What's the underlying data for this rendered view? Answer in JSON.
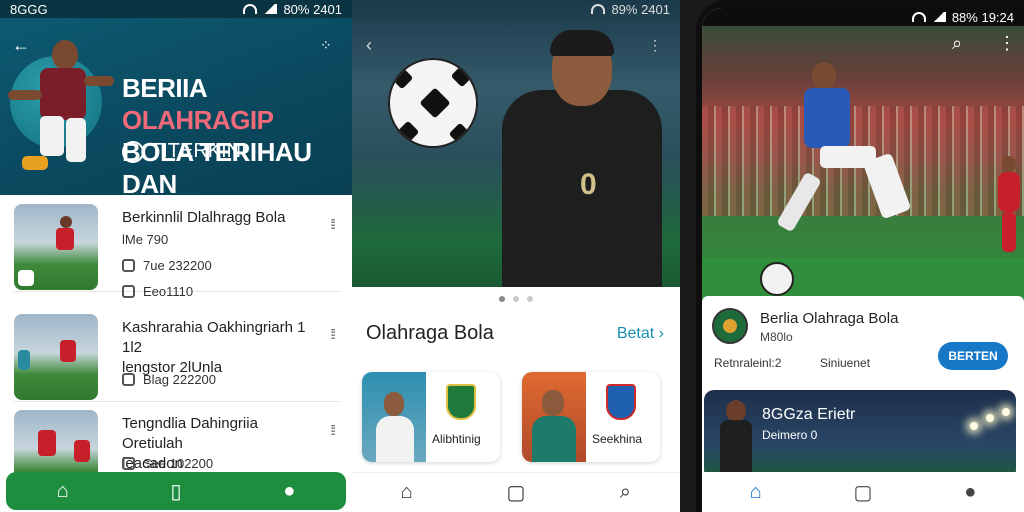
{
  "panel1": {
    "status": {
      "carrier": "8GGG",
      "indicators": "80% 2401"
    },
    "header": {
      "title_line1_a": "BERIIA ",
      "title_line1_b": "OLAHRAGIP",
      "title_line2": "BOLA TERIHAU DAN",
      "subtitle": "TITERKINI"
    },
    "news": [
      {
        "title": "Berkinnlil Dlalhragg Bola",
        "meta1": "lMe 790",
        "meta2": "7ue 232200",
        "meta3": "Eeo1110"
      },
      {
        "title": "Kashrarahia Oakhingriarh 1 1l2",
        "title2": "lengstor 2lUnla",
        "meta1": "Blag 222200"
      },
      {
        "title": "Tengndlia Dahingriia Oretiulah",
        "title2": "leacadon",
        "meta1": "See 102200"
      }
    ],
    "nav_icons": [
      "home-icon",
      "shield-icon",
      "profile-icon"
    ],
    "colors": {
      "header": "#0d5c73",
      "nav": "#1e8e3e",
      "accent": "#f06a7a"
    }
  },
  "panel2": {
    "status": {
      "indicators": "89% 2401"
    },
    "section_title": "Olahraga Bola",
    "section_more": "Betat",
    "cards": [
      {
        "label": "Alibhtinig"
      },
      {
        "label": "Seekhina"
      }
    ],
    "nav_icons": [
      "home-icon",
      "news-icon",
      "search-icon"
    ]
  },
  "panel3": {
    "status": {
      "indicators": "88% 19:24"
    },
    "info": {
      "title": "Berlia Olahraga Bola",
      "subtitle": "M80lo",
      "left": "Retnraleinl:2",
      "mid": "Siniuenet",
      "follow": "BERTEN"
    },
    "promo": {
      "title": "8GGza Erietr",
      "subtitle": "Deimero 0"
    },
    "nav_icons": [
      "home-icon",
      "chat-icon",
      "profile-icon"
    ],
    "colors": {
      "follow": "#1778c8"
    }
  }
}
